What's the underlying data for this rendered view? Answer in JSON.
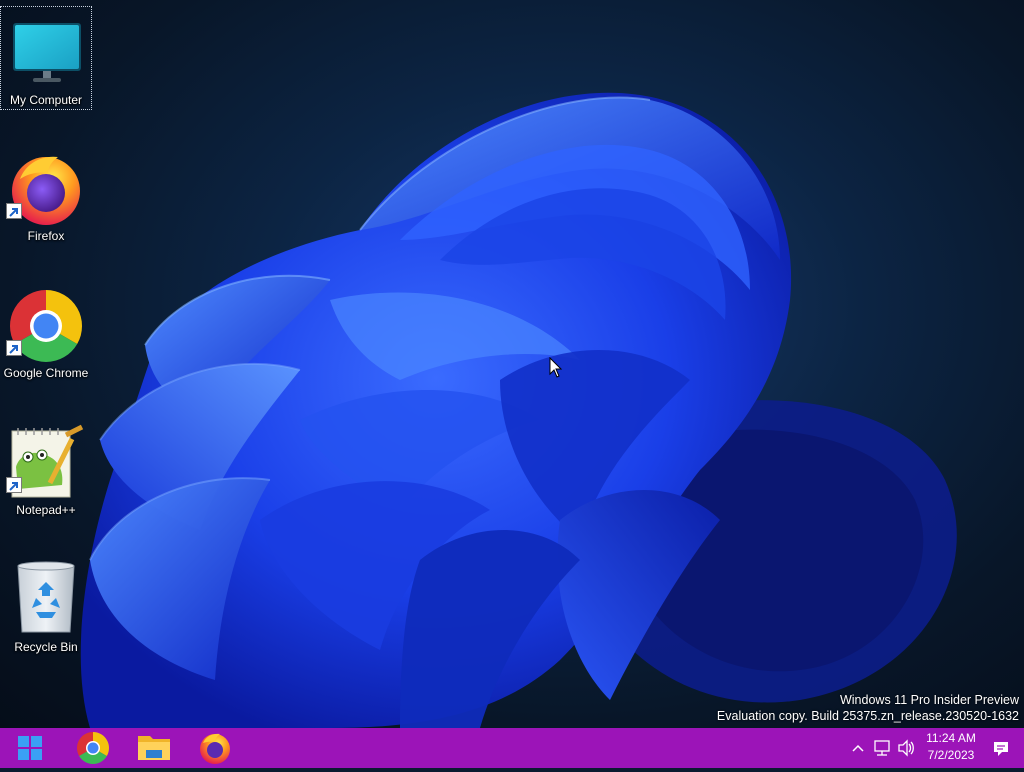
{
  "desktop": {
    "icons": [
      {
        "label": "My Computer",
        "icon": "monitor-icon",
        "shortcut": false,
        "selected": true
      },
      {
        "label": "Firefox",
        "icon": "firefox-icon",
        "shortcut": true
      },
      {
        "label": "Google Chrome",
        "icon": "chrome-icon",
        "shortcut": true
      },
      {
        "label": "Notepad++",
        "icon": "notepadpp-icon",
        "shortcut": true
      },
      {
        "label": "Recycle Bin",
        "icon": "recycle-bin-icon",
        "shortcut": false
      }
    ],
    "watermark": {
      "line1": "Windows 11 Pro Insider Preview",
      "line2": "Evaluation copy. Build 25375.zn_release.230520-1632"
    }
  },
  "taskbar": {
    "color": "#9c14b8",
    "pinned": [
      {
        "name": "start",
        "icon": "windows-start-icon"
      },
      {
        "name": "chrome",
        "icon": "chrome-icon"
      },
      {
        "name": "file-explorer",
        "icon": "folder-icon"
      },
      {
        "name": "firefox",
        "icon": "firefox-icon"
      }
    ],
    "tray": {
      "icons": [
        "chevron-up-icon",
        "network-icon",
        "volume-icon",
        "notification-icon"
      ],
      "time": "11:24 AM",
      "date": "7/2/2023"
    }
  }
}
